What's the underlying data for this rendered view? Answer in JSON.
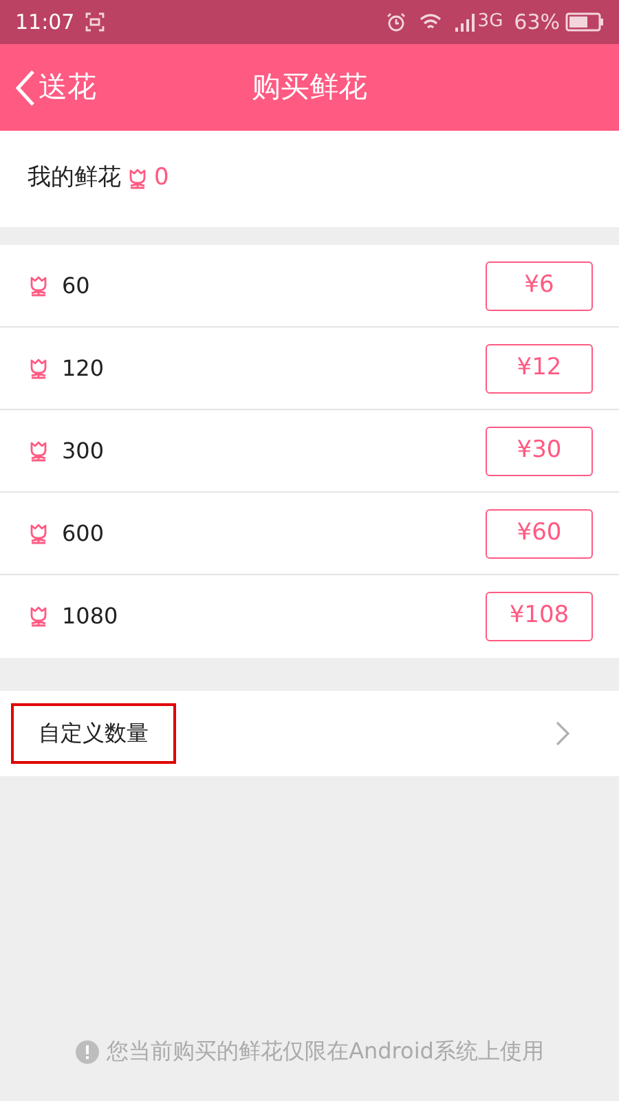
{
  "status_bar": {
    "time": "11:07",
    "network": "3G",
    "battery": "63%"
  },
  "header": {
    "back": "送花",
    "title": "购买鲜花"
  },
  "my_flowers": {
    "label": "我的鲜花",
    "count": "0"
  },
  "packages": [
    {
      "amount": "60",
      "price": "¥6"
    },
    {
      "amount": "120",
      "price": "¥12"
    },
    {
      "amount": "300",
      "price": "¥30"
    },
    {
      "amount": "600",
      "price": "¥60"
    },
    {
      "amount": "1080",
      "price": "¥108"
    }
  ],
  "custom": {
    "label": "自定义数量",
    "highlighted": true
  },
  "notice": "您当前购买的鲜花仅限在Android系统上使用"
}
